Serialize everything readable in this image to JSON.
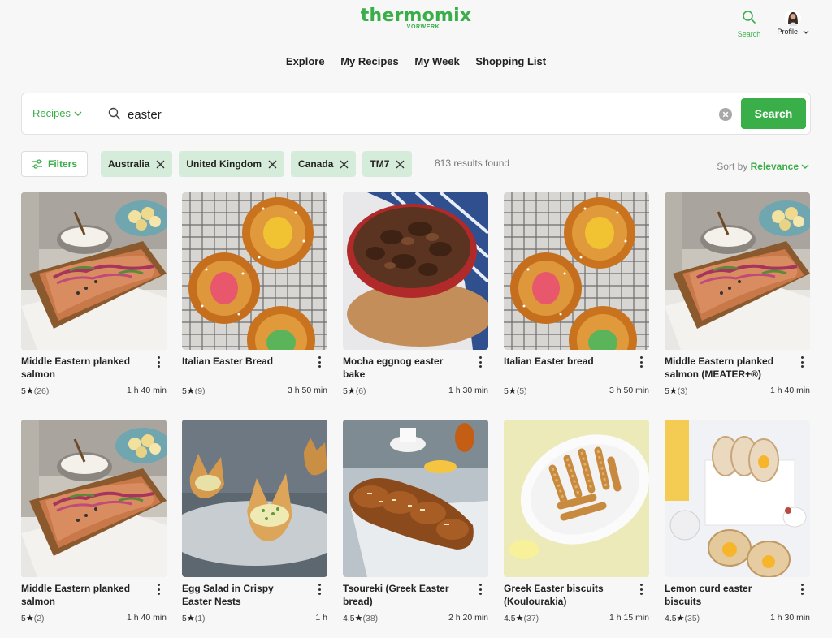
{
  "header": {
    "logo": "thermomix",
    "logo_sub": "VORWERK",
    "search_label": "Search",
    "profile_label": "Profile"
  },
  "nav": [
    "Explore",
    "My Recipes",
    "My Week",
    "Shopping List"
  ],
  "search": {
    "type_label": "Recipes",
    "query": "easter",
    "button_label": "Search"
  },
  "filters": {
    "button_label": "Filters",
    "chips": [
      "Australia",
      "United Kingdom",
      "Canada",
      "TM7"
    ],
    "results_text": "813 results found",
    "sort_prefix": "Sort by",
    "sort_value": "Relevance"
  },
  "colors": {
    "brand": "#3aae49",
    "chip_bg": "#d6ecda"
  },
  "recipes": [
    {
      "title": "Middle Eastern planked salmon",
      "rating": "5",
      "count": "(26)",
      "time": "1 h 40 min",
      "image": "salmon"
    },
    {
      "title": "Italian Easter Bread",
      "rating": "5",
      "count": "(9)",
      "time": "3 h 50 min",
      "image": "easter-bread"
    },
    {
      "title": "Mocha eggnog easter bake",
      "rating": "5",
      "count": "(6)",
      "time": "1 h 30 min",
      "image": "mocha-bake"
    },
    {
      "title": "Italian Easter bread",
      "rating": "5",
      "count": "(5)",
      "time": "3 h 50 min",
      "image": "easter-bread"
    },
    {
      "title": "Middle Eastern planked salmon (MEATER+®)",
      "rating": "5",
      "count": "(3)",
      "time": "1 h 40 min",
      "image": "salmon"
    },
    {
      "title": "Middle Eastern planked salmon",
      "rating": "5",
      "count": "(2)",
      "time": "1 h 40 min",
      "image": "salmon"
    },
    {
      "title": "Egg Salad in Crispy Easter Nests",
      "rating": "5",
      "count": "(1)",
      "time": "1 h",
      "image": "egg-nests"
    },
    {
      "title": "Tsoureki (Greek Easter bread)",
      "rating": "4.5",
      "count": "(38)",
      "time": "2 h 20 min",
      "image": "tsoureki"
    },
    {
      "title": "Greek Easter biscuits (Koulourakia)",
      "rating": "4.5",
      "count": "(37)",
      "time": "1 h 15 min",
      "image": "koulourakia"
    },
    {
      "title": "Lemon curd easter biscuits",
      "rating": "4.5",
      "count": "(35)",
      "time": "1 h 30 min",
      "image": "lemon-biscuits"
    }
  ]
}
